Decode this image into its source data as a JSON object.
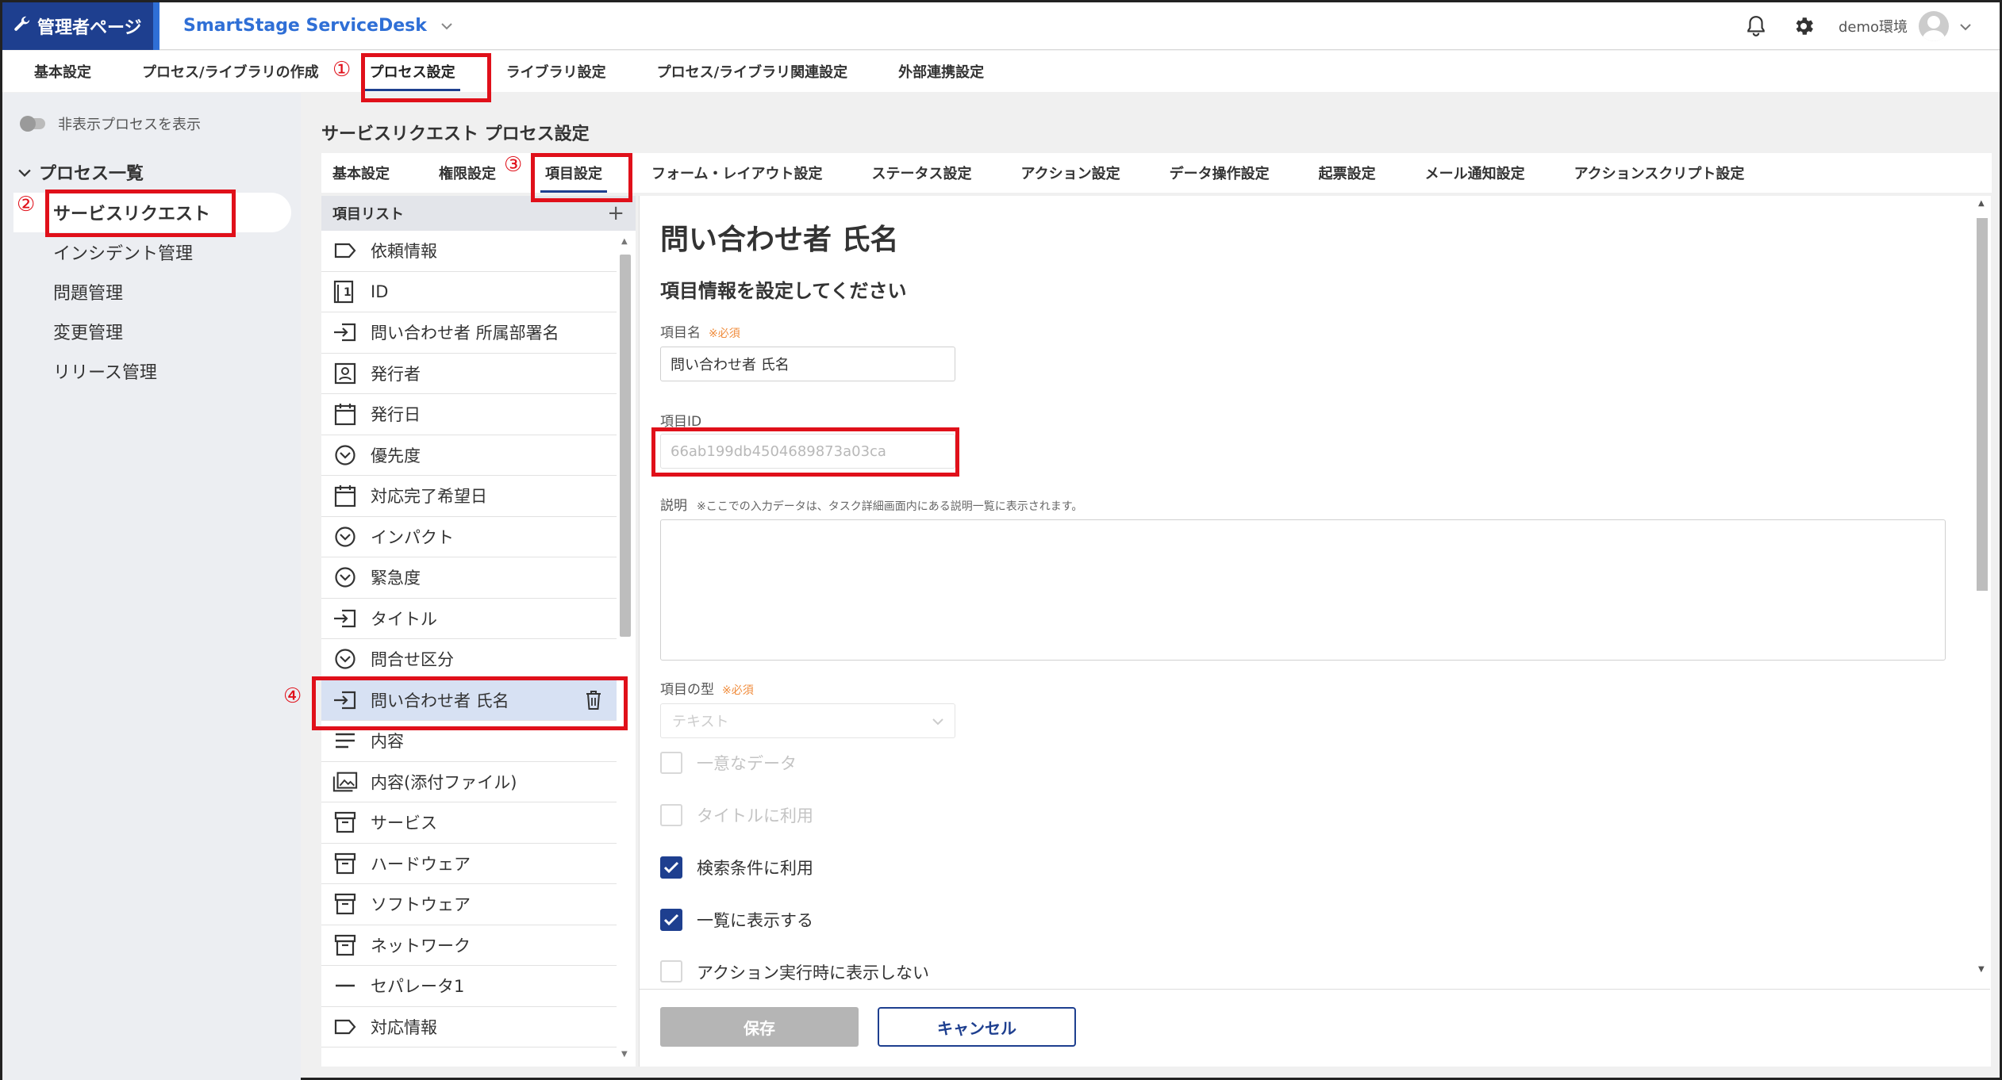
{
  "header": {
    "admin_label": "管理者ページ",
    "app_title": "SmartStage ServiceDesk",
    "user_name": "demo環境"
  },
  "top_tabs": [
    {
      "label": "基本設定"
    },
    {
      "label": "プロセス/ライブラリの作成"
    },
    {
      "label": "プロセス設定"
    },
    {
      "label": "ライブラリ設定"
    },
    {
      "label": "プロセス/ライブラリ関連設定"
    },
    {
      "label": "外部連携設定"
    }
  ],
  "sidebar": {
    "toggle_label": "非表示プロセスを表示",
    "section_title": "プロセス一覧",
    "items": [
      {
        "label": "サービスリクエスト"
      },
      {
        "label": "インシデント管理"
      },
      {
        "label": "問題管理"
      },
      {
        "label": "変更管理"
      },
      {
        "label": "リリース管理"
      }
    ]
  },
  "main": {
    "title": "サービスリクエスト プロセス設定",
    "sub_tabs": [
      {
        "label": "基本設定"
      },
      {
        "label": "権限設定"
      },
      {
        "label": "項目設定"
      },
      {
        "label": "フォーム・レイアウト設定"
      },
      {
        "label": "ステータス設定"
      },
      {
        "label": "アクション設定"
      },
      {
        "label": "データ操作設定"
      },
      {
        "label": "起票設定"
      },
      {
        "label": "メール通知設定"
      },
      {
        "label": "アクションスクリプト設定"
      }
    ]
  },
  "item_list": {
    "header": "項目リスト",
    "items": [
      {
        "label": "依頼情報",
        "icon": "tag-icon"
      },
      {
        "label": "ID",
        "icon": "id-icon"
      },
      {
        "label": "問い合わせ者 所属部署名",
        "icon": "input-icon"
      },
      {
        "label": "発行者",
        "icon": "person-icon"
      },
      {
        "label": "発行日",
        "icon": "calendar-icon"
      },
      {
        "label": "優先度",
        "icon": "dropdown-icon"
      },
      {
        "label": "対応完了希望日",
        "icon": "calendar-icon"
      },
      {
        "label": "インパクト",
        "icon": "dropdown-icon"
      },
      {
        "label": "緊急度",
        "icon": "dropdown-icon"
      },
      {
        "label": "タイトル",
        "icon": "input-icon"
      },
      {
        "label": "問合せ区分",
        "icon": "dropdown-icon"
      },
      {
        "label": "問い合わせ者 氏名",
        "icon": "input-icon"
      },
      {
        "label": "内容",
        "icon": "lines-icon"
      },
      {
        "label": "内容(添付ファイル)",
        "icon": "image-icon"
      },
      {
        "label": "サービス",
        "icon": "archive-icon"
      },
      {
        "label": "ハードウェア",
        "icon": "archive-icon"
      },
      {
        "label": "ソフトウェア",
        "icon": "archive-icon"
      },
      {
        "label": "ネットワーク",
        "icon": "archive-icon"
      },
      {
        "label": "セパレータ1",
        "icon": "separator-icon"
      },
      {
        "label": "対応情報",
        "icon": "tag-icon"
      }
    ]
  },
  "detail": {
    "title": "問い合わせ者 氏名",
    "subtitle": "項目情報を設定してください",
    "name_label": "項目名",
    "required_mark": "※必須",
    "name_value": "問い合わせ者 氏名",
    "id_label": "項目ID",
    "id_value": "66ab199db4504689873a03ca",
    "desc_label": "説明",
    "desc_note": "※ここでの入力データは、タスク詳細画面内にある説明一覧に表示されます。",
    "type_label": "項目の型",
    "type_value": "テキスト",
    "checkboxes": [
      {
        "label": "一意なデータ",
        "checked": false,
        "disabled": true
      },
      {
        "label": "タイトルに利用",
        "checked": false,
        "disabled": true
      },
      {
        "label": "検索条件に利用",
        "checked": true,
        "disabled": false
      },
      {
        "label": "一覧に表示する",
        "checked": true,
        "disabled": false
      },
      {
        "label": "アクション実行時に表示しない",
        "checked": false,
        "disabled": false
      }
    ],
    "save_label": "保存",
    "cancel_label": "キャンセル"
  },
  "annotations": [
    "①",
    "②",
    "③",
    "④"
  ],
  "colors": {
    "brand": "#1e3f8f",
    "accent": "#2f6fd6",
    "annotation": "#e0101a",
    "required": "#f08c3c"
  }
}
